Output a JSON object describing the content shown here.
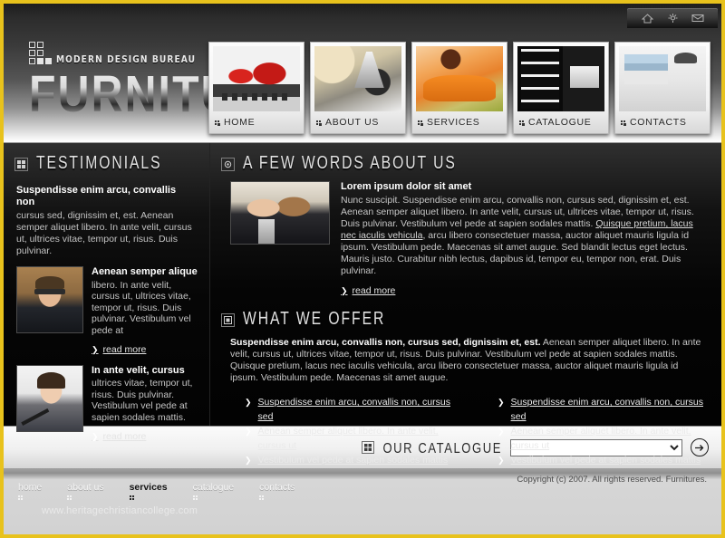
{
  "site": {
    "brand_tagline": "MODERN DESIGN BUREAU",
    "brand_name": "FURNITURE"
  },
  "toolstrip": {
    "items": [
      {
        "icon": "home-icon",
        "title": "home"
      },
      {
        "icon": "sitemap-icon",
        "title": "site map"
      },
      {
        "icon": "mail-icon",
        "title": "mail"
      }
    ]
  },
  "nav": {
    "items": [
      {
        "label": "HOME",
        "art": "art-home"
      },
      {
        "label": "ABOUT US",
        "art": "art-about"
      },
      {
        "label": "SERVICES",
        "art": "art-services"
      },
      {
        "label": "CATALOGUE",
        "art": "art-catalogue"
      },
      {
        "label": "CONTACTS",
        "art": "art-contacts"
      }
    ]
  },
  "sidebar": {
    "heading": "TESTIMONIALS",
    "intro_title": "Suspendisse enim arcu, convallis non",
    "intro_text": "cursus sed, dignissim et, est. Aenean semper aliquet libero. In ante velit, cursus ut, ultrices vitae, tempor ut, risus. Duis pulvinar.",
    "testimonials": [
      {
        "photo": "photo-man",
        "title": "Aenean semper alique",
        "text": "libero. In ante velit, cursus ut, ultrices vitae, tempor ut, risus. Duis pulvinar. Vestibulum vel pede at",
        "read_more": "read more"
      },
      {
        "photo": "photo-woman",
        "title": "In ante velit, cursus",
        "text": "ultrices vitae, tempor ut, risus. Duis pulvinar. Vestibulum vel pede at sapien sodales mattis.",
        "read_more": "read more"
      }
    ]
  },
  "about": {
    "heading": "A FEW WORDS ABOUT US",
    "lead": "Lorem ipsum dolor sit amet",
    "text_before_link": "Nunc suscipit. Suspendisse enim arcu, convallis non, cursus sed, dignissim et, est. Aenean semper aliquet libero. In ante velit, cursus ut, ultrices vitae, tempor ut, risus. Duis pulvinar. Vestibulum vel pede at sapien sodales mattis. ",
    "link_text": "Quisque pretium, lacus nec iaculis vehicula",
    "text_after_link": ", arcu libero consectetuer massa, auctor aliquet mauris ligula id ipsum. Vestibulum pede. Maecenas sit amet augue. Sed blandit lectus eget lectus. Mauris justo. Curabitur nibh lectus, dapibus id, tempor eu, tempor non, erat. Duis pulvinar.",
    "read_more": "read more"
  },
  "offer": {
    "heading": "WHAT WE OFFER",
    "lead": "Suspendisse enim arcu, convallis non, cursus sed, dignissim et, est.",
    "text": " Aenean semper aliquet libero. In ante velit, cursus ut, ultrices vitae, tempor ut, risus. Duis pulvinar. Vestibulum vel pede at sapien sodales mattis. Quisque pretium, lacus nec iaculis vehicula, arcu libero consectetuer massa, auctor aliquet mauris ligula id ipsum. Vestibulum pede. Maecenas sit amet augue.",
    "list_left": [
      "Suspendisse enim arcu, convallis non, cursus sed",
      "Aenean semper aliquet libero. In ante velit, cursus ut",
      "Vestibulum vel pede at sapien sodales mattis"
    ],
    "list_right": [
      "Suspendisse enim arcu, convallis non, cursus sed",
      "Aenean semper aliquet libero. In ante velit, cursus ut",
      "Vestibulum vel pede at sapien sodales mattis"
    ]
  },
  "catalogue": {
    "title": "OUR CATALOGUE",
    "selected_value": "",
    "options": [
      ""
    ],
    "go_label": "→"
  },
  "footer": {
    "links": [
      {
        "label": "home",
        "active": false
      },
      {
        "label": "about us",
        "active": false
      },
      {
        "label": "services",
        "active": true
      },
      {
        "label": "catalogue",
        "active": false
      },
      {
        "label": "contacts",
        "active": false
      }
    ],
    "watermark": "www.heritagechristiancollege.com",
    "copyright": "Copyright (c) 2007. All rights reserved. Furnitures."
  },
  "colors": {
    "frame_yellow": "#e8c21c",
    "dark_panel": "#0b0b0b",
    "footer_grey": "#d2d2d2"
  }
}
